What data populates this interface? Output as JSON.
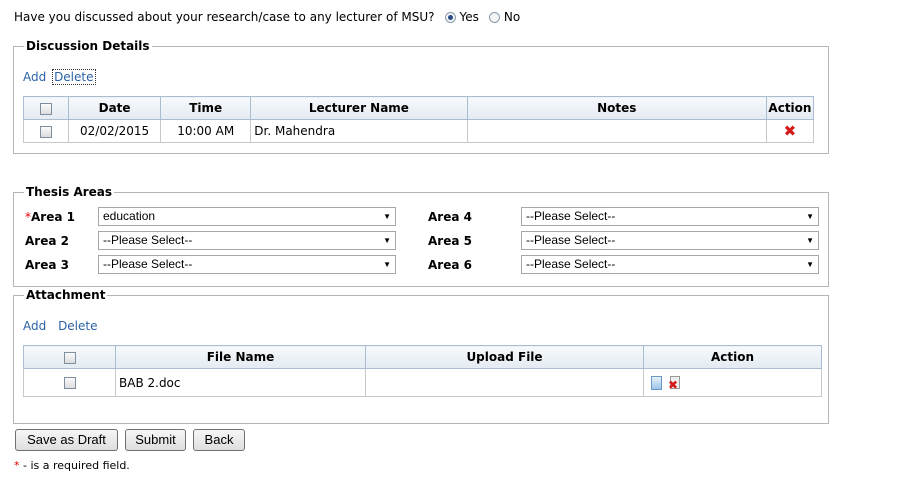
{
  "question": {
    "text": "Have you discussed about your research/case to any lecturer of MSU?",
    "yes_label": "Yes",
    "no_label": "No",
    "selected": "Yes"
  },
  "discussion": {
    "legend": "Discussion Details",
    "add_label": "Add",
    "delete_label": "Delete",
    "columns": [
      "Date",
      "Time",
      "Lecturer Name",
      "Notes",
      "Action"
    ],
    "rows": [
      {
        "date": "02/02/2015",
        "time": "10:00 AM",
        "lecturer": "Dr. Mahendra",
        "notes": ""
      }
    ]
  },
  "thesis": {
    "legend": "Thesis Areas",
    "required_mark": "*",
    "areas": [
      {
        "label": "Area 1",
        "value": "education",
        "required": true
      },
      {
        "label": "Area 2",
        "value": "--Please Select--"
      },
      {
        "label": "Area 3",
        "value": "--Please Select--"
      },
      {
        "label": "Area 4",
        "value": "--Please Select--"
      },
      {
        "label": "Area 5",
        "value": "--Please Select--"
      },
      {
        "label": "Area 6",
        "value": "--Please Select--"
      }
    ]
  },
  "attachment": {
    "legend": "Attachment",
    "add_label": "Add",
    "delete_label": "Delete",
    "columns": [
      "File Name",
      "Upload File",
      "Action"
    ],
    "rows": [
      {
        "file_name": "BAB 2.doc",
        "upload": ""
      }
    ]
  },
  "buttons": {
    "draft": "Save as Draft",
    "submit": "Submit",
    "back": "Back"
  },
  "footer": {
    "star": "*",
    "text": " - is a required field."
  },
  "icons": {
    "delete_row": "delete-x-icon",
    "view_file": "document-icon",
    "delete_file": "delete-file-icon"
  },
  "colors": {
    "link": "#2b62a6",
    "required": "#dd0000",
    "delete": "#d61a1a"
  }
}
